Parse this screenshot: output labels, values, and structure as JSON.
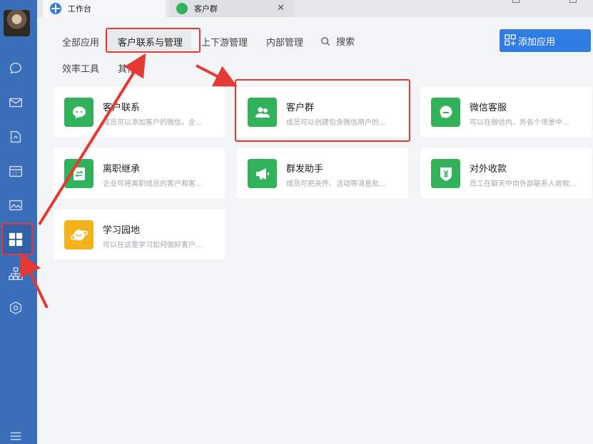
{
  "tabs": [
    {
      "label": "工作台"
    },
    {
      "label": "客户群"
    }
  ],
  "nav": {
    "row1": [
      "全部应用",
      "客户联系与管理",
      "上下游管理",
      "内部管理"
    ],
    "search": "搜索",
    "row2": [
      "效率工具",
      "其他"
    ]
  },
  "add_app_label": "添加应用",
  "cards": [
    {
      "title": "客户联系",
      "desc": "成员可以添加客户的微信，企...",
      "icon": "chat-bubble-icon",
      "color": "#31b15a"
    },
    {
      "title": "客户群",
      "desc": "成员可以创建包含微信用户的...",
      "icon": "people-icon",
      "color": "#31b15a"
    },
    {
      "title": "微信客服",
      "desc": "可以在微信内、外各个场景中...",
      "icon": "service-bubble-icon",
      "color": "#31b15a"
    },
    {
      "title": "离职继承",
      "desc": "企业可将离职成员的客户和客...",
      "icon": "transfer-doc-icon",
      "color": "#31b15a"
    },
    {
      "title": "群发助手",
      "desc": "成员可把关怀、活动等消息批...",
      "icon": "megaphone-icon",
      "color": "#31b15a"
    },
    {
      "title": "对外收款",
      "desc": "员工在聊天中向外部联系人收款...",
      "icon": "yuan-shield-icon",
      "color": "#31b15a"
    },
    {
      "title": "学习园地",
      "desc": "可以在这里学习如何做好客户...",
      "icon": "planet-icon",
      "color": "#f5b21a"
    }
  ],
  "colors": {
    "sidebar": "#3a6eb8",
    "accent": "#2f7de1",
    "highlight": "#e53935"
  }
}
